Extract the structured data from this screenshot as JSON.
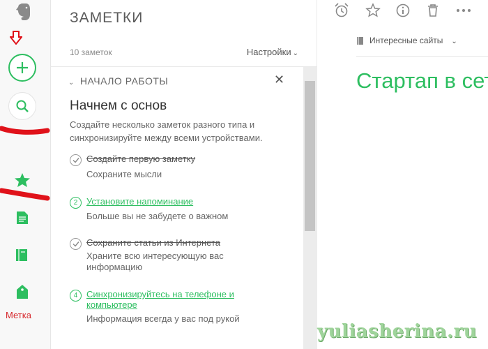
{
  "sidebar": {
    "tag_label": "Метка"
  },
  "notes_panel": {
    "title": "ЗАМЕТКИ",
    "count": "10 заметок",
    "settings_label": "Настройки"
  },
  "getting_started": {
    "header": "НАЧАЛО РАБОТЫ",
    "heading": "Начнем с основ",
    "intro": "Создайте несколько заметок разного типа и синхронизируйте между всеми устройствами.",
    "steps": [
      {
        "title": "Создайте первую заметку",
        "subtitle": "Сохраните мысли",
        "done": true,
        "number": ""
      },
      {
        "title": "Установите напоминание",
        "subtitle": "Больше вы не забудете о важном",
        "done": false,
        "number": "2"
      },
      {
        "title": "Сохраните статьи из Интернета",
        "subtitle": "Храните всю интересующую вас информацию",
        "done": true,
        "number": ""
      },
      {
        "title": "Синхронизируйтесь на телефоне и компьютере",
        "subtitle": "Информация всегда у вас под рукой",
        "done": false,
        "number": "4"
      }
    ]
  },
  "editor": {
    "notebook": "Интересные сайты",
    "note_title": "Стартап в сети"
  },
  "watermark": "yuliasherina.ru",
  "colors": {
    "accent": "#2dbe60",
    "annotation": "#e0121a"
  }
}
